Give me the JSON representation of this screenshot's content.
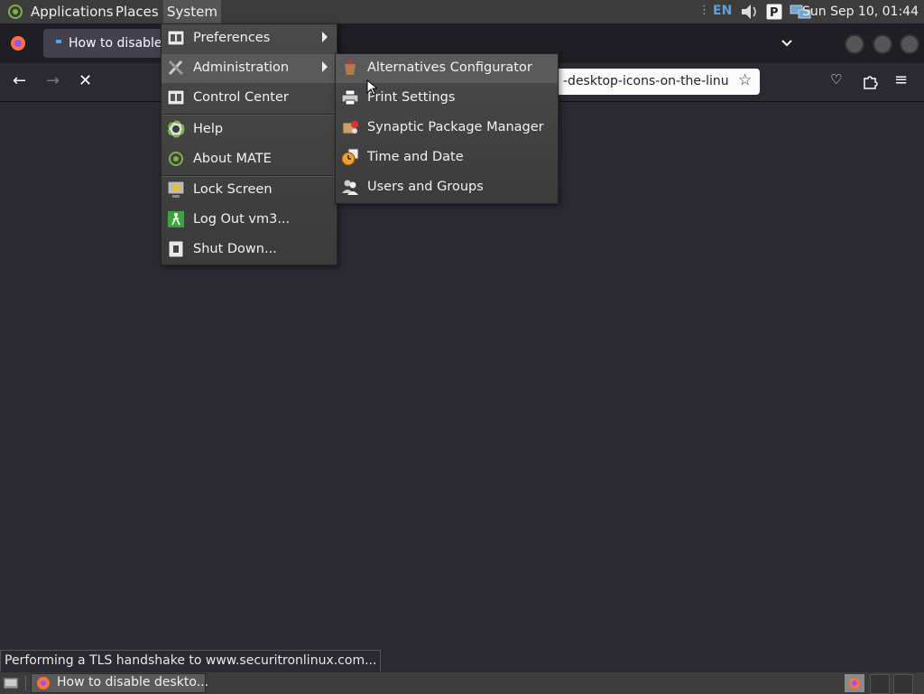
{
  "top_panel": {
    "applications": "Applications",
    "places": "Places",
    "system": "System",
    "keyboard_layout": "EN",
    "clock": "Sun Sep 10, 01:44"
  },
  "browser": {
    "tab_title": "How to disable d",
    "url_fragment": "-desktop-icons-on-the-linu"
  },
  "system_menu": [
    {
      "label": "Preferences",
      "icon": "preferences-icon",
      "submenu": true
    },
    {
      "label": "Administration",
      "icon": "administration-icon",
      "submenu": true,
      "highlighted": true
    },
    {
      "label": "Control Center",
      "icon": "control-center-icon"
    },
    {
      "label": "Help",
      "icon": "help-icon"
    },
    {
      "label": "About MATE",
      "icon": "about-mate-icon"
    },
    {
      "label": "Lock Screen",
      "icon": "lock-screen-icon"
    },
    {
      "label": "Log Out vm3...",
      "icon": "logout-icon"
    },
    {
      "label": "Shut Down...",
      "icon": "shutdown-icon"
    }
  ],
  "admin_submenu": [
    {
      "label": "Alternatives Configurator",
      "icon": "alternatives-icon",
      "highlighted": true
    },
    {
      "label": "Print Settings",
      "icon": "printer-icon"
    },
    {
      "label": "Synaptic Package Manager",
      "icon": "synaptic-icon"
    },
    {
      "label": "Time and Date",
      "icon": "clock-icon"
    },
    {
      "label": "Users and Groups",
      "icon": "users-icon"
    }
  ],
  "status_text": "Performing a TLS handshake to www.securitronlinux.com...",
  "taskbar": {
    "window_title": "How to disable deskto..."
  },
  "colors": {
    "panel": "#3c3c3c",
    "menu_highlight": "#5a5a5a",
    "content": "#2b2a33"
  }
}
